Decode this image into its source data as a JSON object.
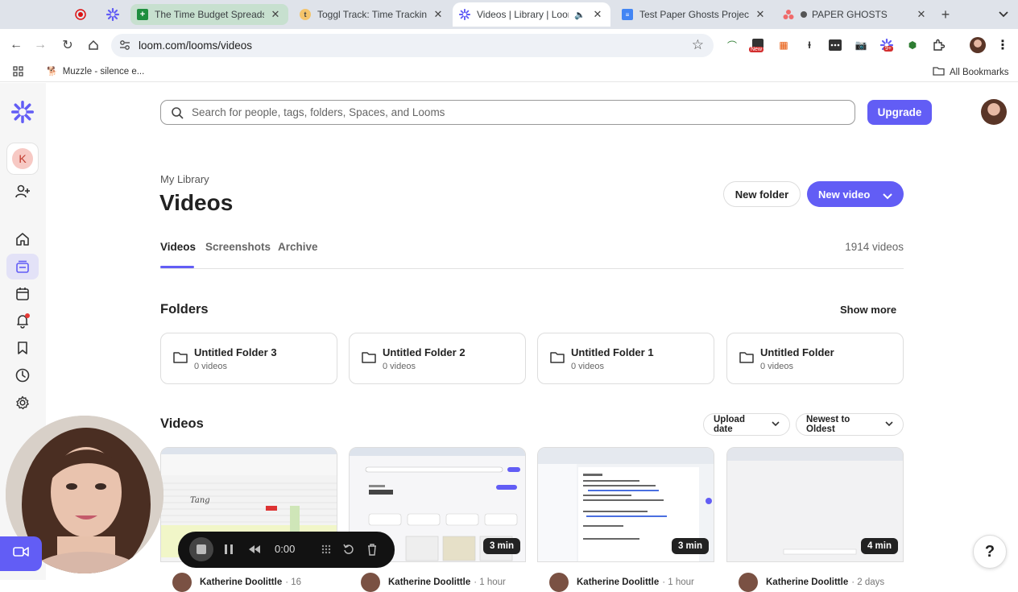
{
  "browser": {
    "tabs": [
      {
        "title": "The Time Budget Spreadsh",
        "favicon": "sheets-icon"
      },
      {
        "title": "Toggl Track: Time Tracking",
        "favicon": "toggl-icon"
      },
      {
        "title": "Videos | Library | Loom",
        "favicon": "loom-icon",
        "active": true
      },
      {
        "title": "Test Paper Ghosts Project -",
        "favicon": "docs-icon"
      },
      {
        "title": "PAPER GHOSTS",
        "favicon": "asana-icon"
      }
    ],
    "url": "loom.com/looms/videos",
    "bookmark": "Muzzle - silence e...",
    "all_bookmarks": "All Bookmarks",
    "ext_badges": {
      "new": "New",
      "count": "9+"
    }
  },
  "header": {
    "search_placeholder": "Search for people, tags, folders, Spaces, and Looms",
    "upgrade_label": "Upgrade"
  },
  "sidebar": {
    "workspace_initial": "K"
  },
  "library": {
    "breadcrumb": "My Library",
    "title": "Videos",
    "new_folder_label": "New folder",
    "new_video_label": "New video",
    "tabs": [
      "Videos",
      "Screenshots",
      "Archive"
    ],
    "count": "1914 videos"
  },
  "folders": {
    "heading": "Folders",
    "show_more": "Show more",
    "items": [
      {
        "name": "Untitled Folder 3",
        "count": "0 videos"
      },
      {
        "name": "Untitled Folder 2",
        "count": "0 videos"
      },
      {
        "name": "Untitled Folder 1",
        "count": "0 videos"
      },
      {
        "name": "Untitled Folder",
        "count": "0 videos"
      }
    ]
  },
  "videos": {
    "heading": "Videos",
    "sort_field": "Upload date",
    "sort_order": "Newest to Oldest",
    "items": [
      {
        "duration": "",
        "author": "Katherine Doolittle",
        "when": "· 16"
      },
      {
        "duration": "3 min",
        "author": "Katherine Doolittle",
        "when": "· 1 hour"
      },
      {
        "duration": "3 min",
        "author": "Katherine Doolittle",
        "when": "· 1 hour"
      },
      {
        "duration": "4 min",
        "author": "Katherine Doolittle",
        "when": "· 2 days"
      }
    ]
  },
  "recorder": {
    "time": "0:00"
  },
  "help": "?"
}
